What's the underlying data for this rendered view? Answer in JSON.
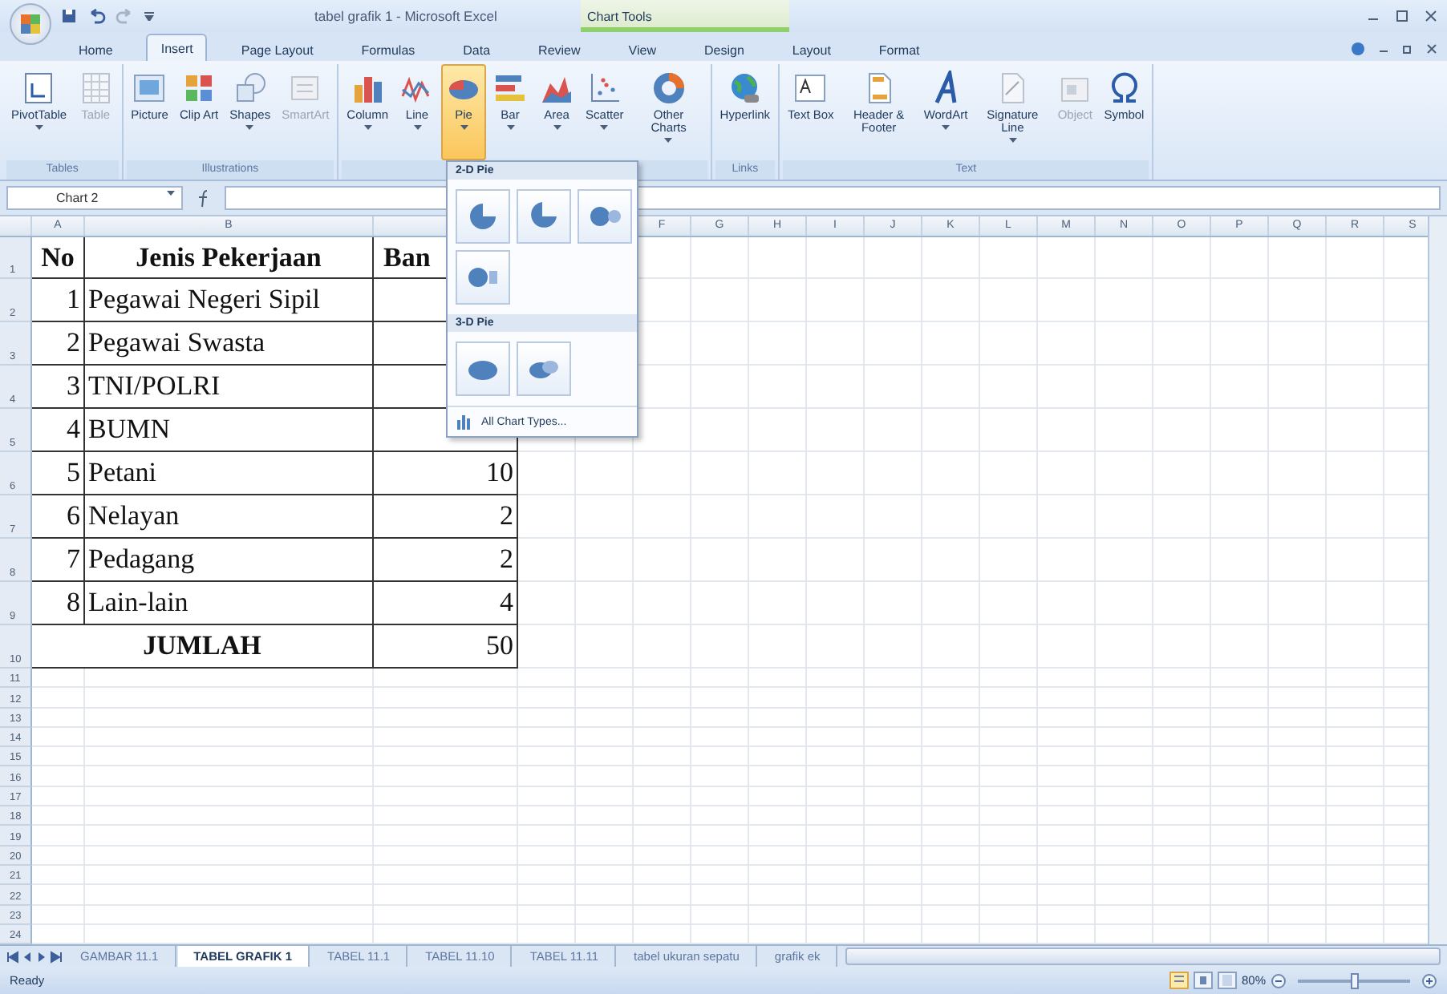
{
  "window": {
    "title": "tabel grafik 1 - Microsoft Excel",
    "contextual_label": "Chart Tools"
  },
  "tabs": [
    {
      "label": "Home",
      "selected": false
    },
    {
      "label": "Insert",
      "selected": true
    },
    {
      "label": "Page Layout",
      "selected": false
    },
    {
      "label": "Formulas",
      "selected": false
    },
    {
      "label": "Data",
      "selected": false
    },
    {
      "label": "Review",
      "selected": false
    },
    {
      "label": "View",
      "selected": false
    },
    {
      "label": "Design",
      "selected": false
    },
    {
      "label": "Layout",
      "selected": false
    },
    {
      "label": "Format",
      "selected": false
    }
  ],
  "ribbon": {
    "groups": [
      {
        "label": "Tables",
        "items": [
          {
            "label": "PivotTable",
            "menu": true,
            "disabled": false,
            "selected": false
          },
          {
            "label": "Table",
            "menu": false,
            "disabled": true,
            "selected": false
          }
        ]
      },
      {
        "label": "Illustrations",
        "items": [
          {
            "label": "Picture",
            "menu": false,
            "disabled": false,
            "selected": false
          },
          {
            "label": "Clip Art",
            "menu": false,
            "disabled": false,
            "selected": false
          },
          {
            "label": "Shapes",
            "menu": true,
            "disabled": false,
            "selected": false
          },
          {
            "label": "SmartArt",
            "menu": false,
            "disabled": true,
            "selected": false
          }
        ]
      },
      {
        "items": [
          {
            "label": "Column",
            "menu": true,
            "disabled": false,
            "selected": false
          },
          {
            "label": "Line",
            "menu": true,
            "disabled": false,
            "selected": false
          },
          {
            "label": "Pie",
            "menu": true,
            "disabled": false,
            "selected": true
          },
          {
            "label": "Bar",
            "menu": true,
            "disabled": false,
            "selected": false
          },
          {
            "label": "Area",
            "menu": true,
            "disabled": false,
            "selected": false
          },
          {
            "label": "Scatter",
            "menu": true,
            "disabled": false,
            "selected": false
          },
          {
            "label": "Other Charts",
            "menu": true,
            "disabled": false,
            "selected": false
          }
        ]
      },
      {
        "label": "Links",
        "items": [
          {
            "label": "Hyperlink",
            "menu": false,
            "disabled": false,
            "selected": false
          }
        ]
      },
      {
        "label": "Text",
        "items": [
          {
            "label": "Text Box",
            "menu": false,
            "disabled": false,
            "selected": false
          },
          {
            "label": "Header & Footer",
            "menu": false,
            "disabled": false,
            "selected": false
          },
          {
            "label": "WordArt",
            "menu": true,
            "disabled": false,
            "selected": false
          },
          {
            "label": "Signature Line",
            "menu": true,
            "disabled": false,
            "selected": false
          },
          {
            "label": "Object",
            "menu": false,
            "disabled": true,
            "selected": false
          },
          {
            "label": "Symbol",
            "menu": false,
            "disabled": false,
            "selected": false
          }
        ]
      }
    ]
  },
  "pie_menu": {
    "sections": [
      {
        "label": "2-D Pie"
      },
      {
        "label": "3-D Pie"
      }
    ],
    "footer": "All Chart Types..."
  },
  "formula_bar": {
    "name_box": "Chart 2"
  },
  "column_headers": [
    "A",
    "B",
    "F",
    "G",
    "H",
    "I",
    "J",
    "K",
    "L",
    "M",
    "N",
    "O",
    "P",
    "Q",
    "R",
    "S"
  ],
  "row_numbers": [
    "1",
    "2",
    "3",
    "4",
    "5",
    "6",
    "7",
    "8",
    "9",
    "10",
    "11",
    "12",
    "13",
    "14",
    "15",
    "16",
    "17",
    "18",
    "19",
    "20",
    "21",
    "22",
    "23",
    "24"
  ],
  "table": {
    "header": [
      "No",
      "Jenis Pekerjaan",
      "Ban"
    ],
    "rows": [
      {
        "no": "1",
        "job": "Pegawai Negeri Sipil"
      },
      {
        "no": "2",
        "job": "Pegawai Swasta"
      },
      {
        "no": "3",
        "job": "TNI/POLRI"
      },
      {
        "no": "4",
        "job": "BUMN"
      },
      {
        "no": "5",
        "job": "Petani",
        "count": "10"
      },
      {
        "no": "6",
        "job": "Nelayan",
        "count": "2"
      },
      {
        "no": "7",
        "job": "Pedagang",
        "count": "2"
      },
      {
        "no": "8",
        "job": "Lain-lain",
        "count": "4"
      }
    ],
    "total": {
      "label": "JUMLAH",
      "count": "50"
    }
  },
  "sheet_tabs": [
    {
      "label": "GAMBAR 11.1",
      "selected": false
    },
    {
      "label": "TABEL GRAFIK 1",
      "selected": true
    },
    {
      "label": "TABEL 11.1",
      "selected": false
    },
    {
      "label": "TABEL 11.10",
      "selected": false
    },
    {
      "label": "TABEL 11.11",
      "selected": false
    },
    {
      "label": "tabel ukuran sepatu",
      "selected": false
    },
    {
      "label": "grafik ek",
      "selected": false
    }
  ],
  "status_bar": {
    "text": "Ready",
    "zoom": "80%",
    "zoom_slider": {
      "level": 0.5
    }
  }
}
